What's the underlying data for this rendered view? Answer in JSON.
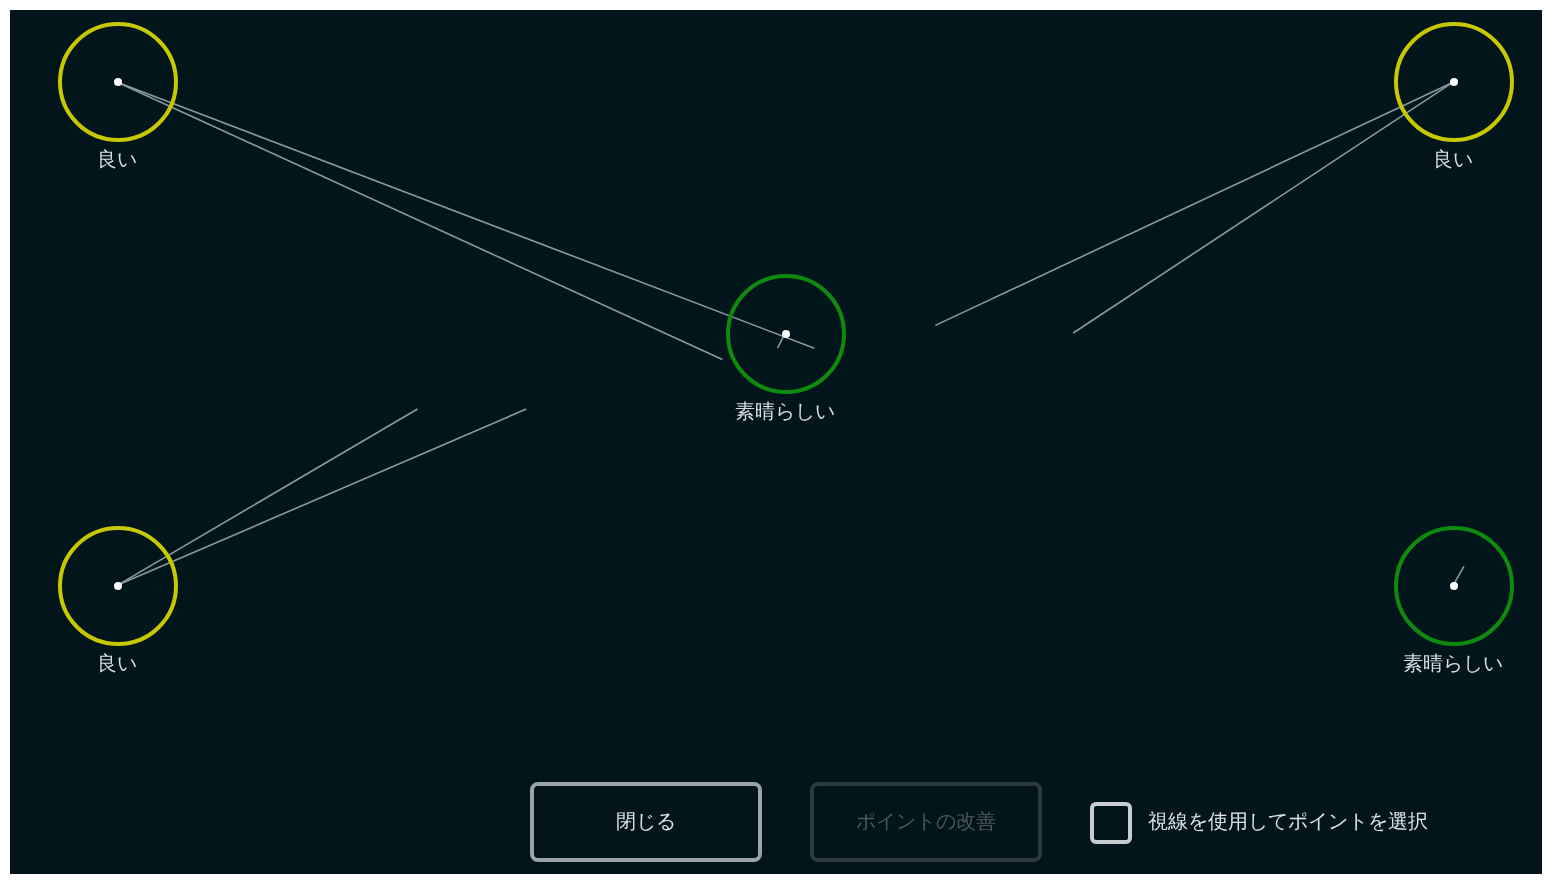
{
  "points": [
    {
      "label": "良い",
      "color": "#c8c800"
    },
    {
      "label": "良い",
      "color": "#c8c800"
    },
    {
      "label": "素晴らしい",
      "color": "#0e8a0e"
    },
    {
      "label": "良い",
      "color": "#c8c800"
    },
    {
      "label": "素晴らしい",
      "color": "#0e8a0e"
    }
  ],
  "buttons": [
    {
      "label": "閉じる",
      "disabled": false
    },
    {
      "label": "ポイントの改善",
      "disabled": true
    }
  ],
  "gaze_select": {
    "label": "視線を使用してポイントを選択",
    "checked": false
  }
}
